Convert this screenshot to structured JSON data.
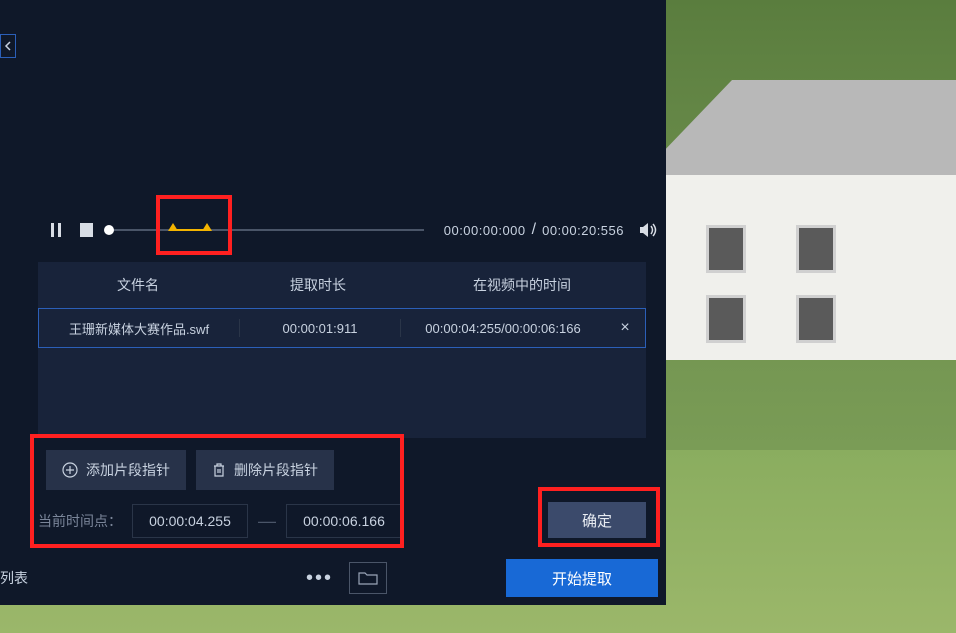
{
  "playback": {
    "current_time": "00:00:00:000",
    "total_time": "00:00:20:556"
  },
  "table": {
    "headers": {
      "filename": "文件名",
      "duration": "提取时长",
      "range": "在视频中的时间"
    },
    "row": {
      "filename": "王珊新媒体大赛作品.swf",
      "duration": "00:00:01:911",
      "range": "00:00:04:255/00:00:06:166"
    }
  },
  "pointer_buttons": {
    "add": "添加片段指针",
    "delete": "删除片段指针"
  },
  "time_range": {
    "label": "当前时间点：",
    "start": "00:00:04.255",
    "end": "00:00:06.166"
  },
  "confirm": "确定",
  "bottom": {
    "list": "列表",
    "start_extract": "开始提取"
  }
}
